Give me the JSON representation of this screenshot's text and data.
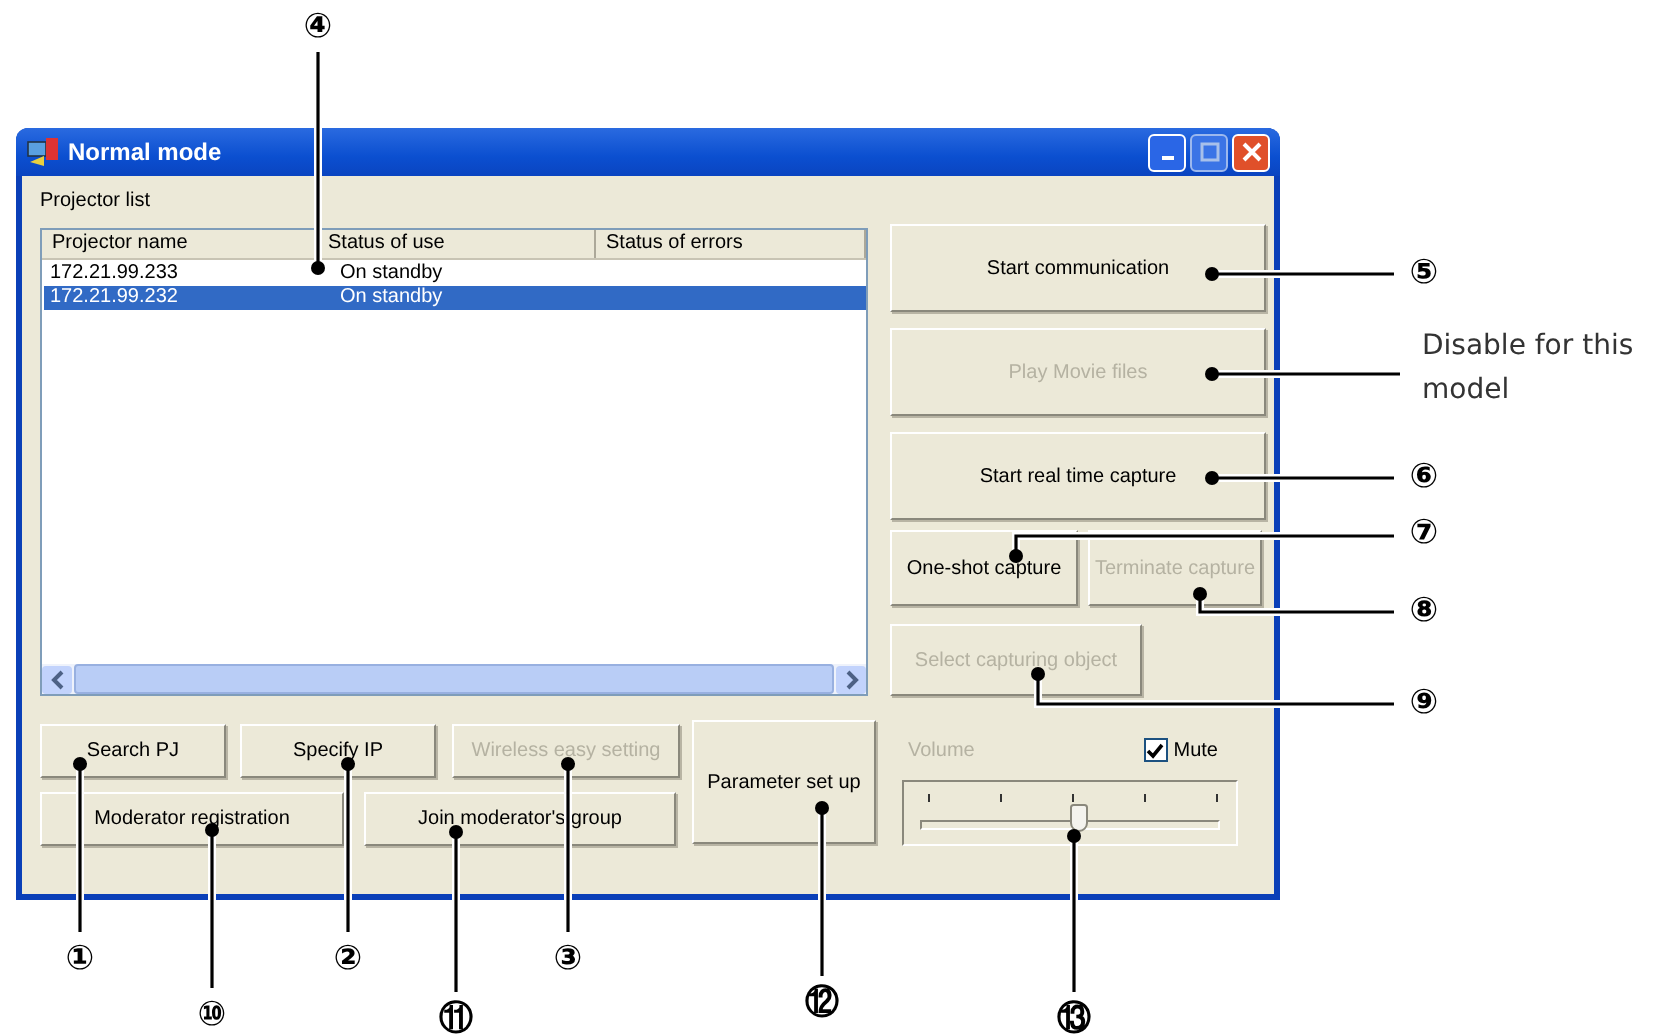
{
  "window": {
    "title": "Normal mode"
  },
  "projector_list": {
    "label": "Projector list",
    "columns": [
      "Projector name",
      "Status of use",
      "Status of errors"
    ],
    "rows": [
      {
        "cells": [
          "172.21.99.233",
          "On standby",
          ""
        ],
        "selected": false
      },
      {
        "cells": [
          "172.21.99.232",
          "On standby",
          ""
        ],
        "selected": true
      }
    ]
  },
  "side_buttons": [
    {
      "label": "Start communication",
      "disabled": false
    },
    {
      "label": "Play Movie files",
      "disabled": true
    },
    {
      "label": "Start real time capture",
      "disabled": false
    }
  ],
  "capture_buttons": [
    {
      "label": "One-shot capture",
      "disabled": false
    },
    {
      "label": "Terminate capture",
      "disabled": true
    }
  ],
  "select_button": {
    "label": "Select capturing object",
    "disabled": true
  },
  "bottom_buttons": [
    {
      "label": "Search PJ",
      "disabled": false
    },
    {
      "label": "Specify IP",
      "disabled": false
    },
    {
      "label": "Wireless easy setting",
      "disabled": true
    },
    {
      "label": "Moderator registration",
      "disabled": false
    },
    {
      "label": "Join moderator's group",
      "disabled": false
    }
  ],
  "parameter_button": {
    "label": "Parameter set up",
    "disabled": false
  },
  "volume": {
    "label": "Volume",
    "disabled": true,
    "level": 0.52,
    "mute_label": "Mute",
    "mute_checked": true
  },
  "callouts": [
    "④",
    "⑤",
    "⑥",
    "⑦",
    "⑧",
    "⑨",
    "①",
    "②",
    "③",
    "⑩",
    "⑪",
    "⑫",
    "⑬"
  ],
  "note": "Disable for this model"
}
